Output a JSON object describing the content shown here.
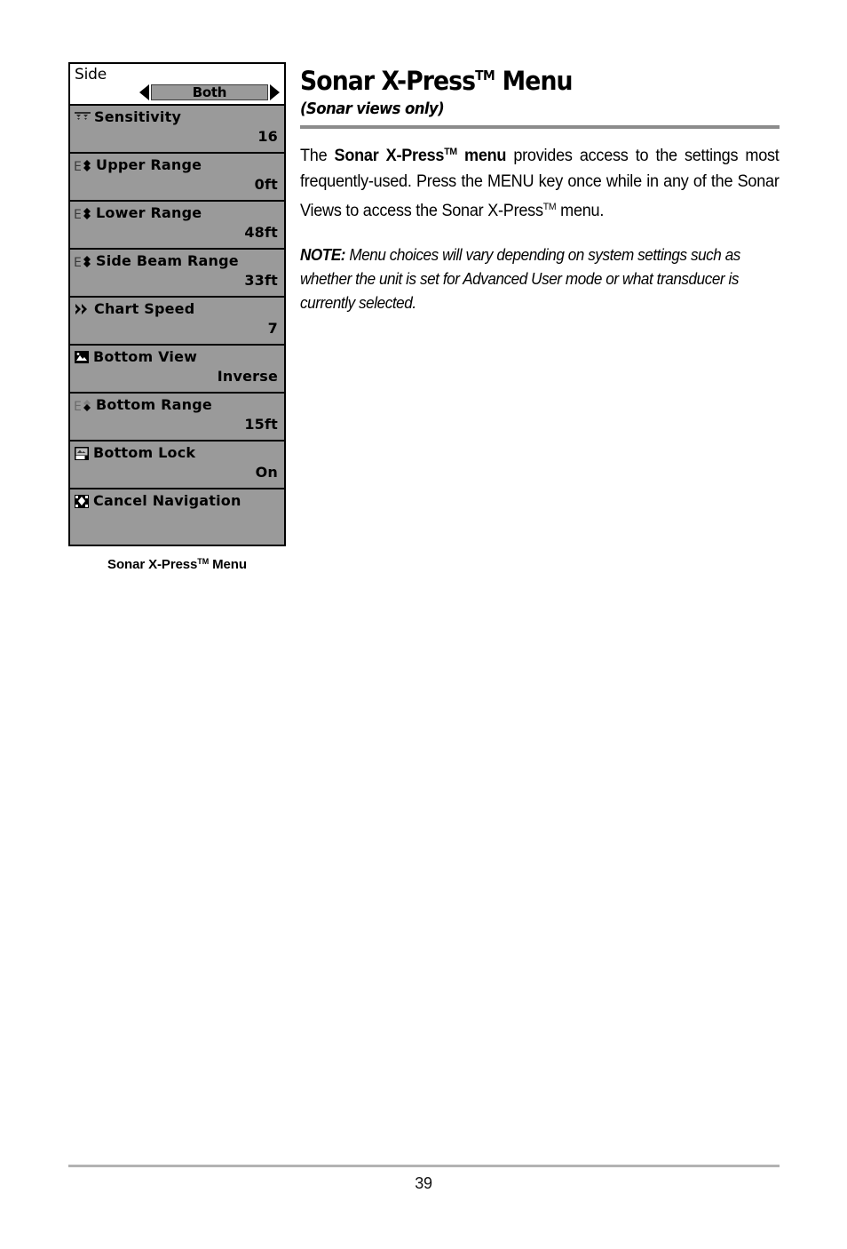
{
  "page": {
    "title": "Sonar X-Press",
    "title_tm": "TM",
    "title_suffix": " Menu",
    "subtitle": "(Sonar views only)",
    "page_number": "39"
  },
  "body": {
    "para1_lead": "The ",
    "para1_bold": "Sonar X-Press",
    "para1_bold_tm": "TM",
    "para1_bold_tail": " menu",
    "para1_mid": " provides access to the settings most frequently-used. Press the MENU key once while in any of the Sonar Views to access the Sonar X-Press",
    "para1_tm2": "TM",
    "para1_end": " menu.",
    "note_label": "NOTE:",
    "note_text": " Menu choices will vary depending on system settings such as whether the unit is set for Advanced User mode or what transducer is currently selected."
  },
  "figure": {
    "caption_text": "Sonar X-Press",
    "caption_tm": "TM",
    "caption_tail": " Menu",
    "header": {
      "title": "Side",
      "selected_value": "Both",
      "left_arrow": "left-arrow-icon",
      "right_arrow": "right-arrow-icon"
    },
    "items": [
      {
        "icon": "sensitivity-waves-icon",
        "label": "Sensitivity",
        "value": "16"
      },
      {
        "icon": "range-updown-icon",
        "label": "Upper Range",
        "value": "0ft"
      },
      {
        "icon": "range-updown-icon",
        "label": "Lower Range",
        "value": "48ft"
      },
      {
        "icon": "range-updown-icon",
        "label": "Side Beam Range",
        "value": "33ft"
      },
      {
        "icon": "chart-speed-chevrons-icon",
        "label": "Chart Speed",
        "value": "7"
      },
      {
        "icon": "bottom-view-image-icon",
        "label": "Bottom View",
        "value": "Inverse"
      },
      {
        "icon": "range-updown-icon",
        "label": "Bottom Range",
        "value": "15ft"
      },
      {
        "icon": "bottom-lock-icon",
        "label": "Bottom Lock",
        "value": "On"
      },
      {
        "icon": "cancel-navigation-icon",
        "label": "Cancel Navigation",
        "value": ""
      }
    ]
  },
  "colors": {
    "lcd_gray": "#9a9a9a",
    "lcd_white": "#ffffff",
    "lcd_black": "#000000",
    "rule_gray": "#8c8c8c",
    "footer_rule_gray": "#b3b3b3"
  }
}
